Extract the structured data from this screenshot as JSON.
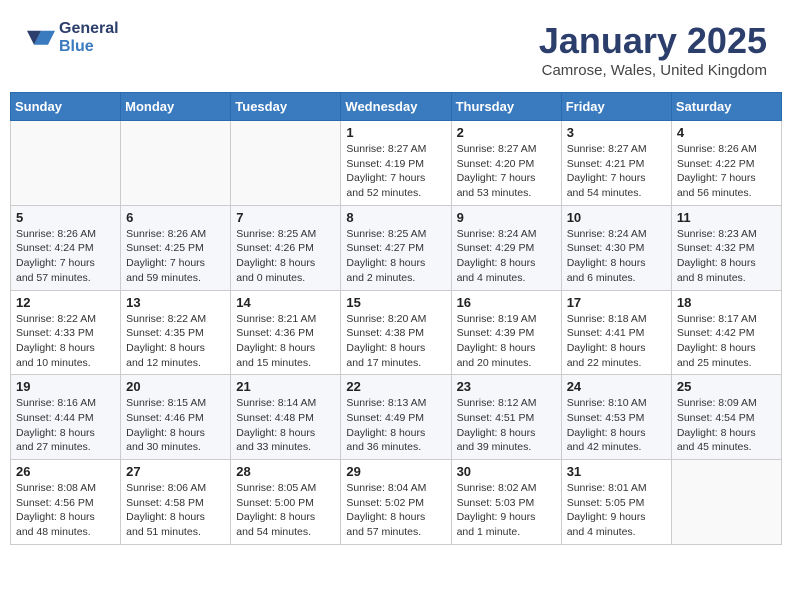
{
  "header": {
    "logo_general": "General",
    "logo_blue": "Blue",
    "month_year": "January 2025",
    "location": "Camrose, Wales, United Kingdom"
  },
  "days_of_week": [
    "Sunday",
    "Monday",
    "Tuesday",
    "Wednesday",
    "Thursday",
    "Friday",
    "Saturday"
  ],
  "weeks": [
    [
      {
        "day": "",
        "info": ""
      },
      {
        "day": "",
        "info": ""
      },
      {
        "day": "",
        "info": ""
      },
      {
        "day": "1",
        "info": "Sunrise: 8:27 AM\nSunset: 4:19 PM\nDaylight: 7 hours and 52 minutes."
      },
      {
        "day": "2",
        "info": "Sunrise: 8:27 AM\nSunset: 4:20 PM\nDaylight: 7 hours and 53 minutes."
      },
      {
        "day": "3",
        "info": "Sunrise: 8:27 AM\nSunset: 4:21 PM\nDaylight: 7 hours and 54 minutes."
      },
      {
        "day": "4",
        "info": "Sunrise: 8:26 AM\nSunset: 4:22 PM\nDaylight: 7 hours and 56 minutes."
      }
    ],
    [
      {
        "day": "5",
        "info": "Sunrise: 8:26 AM\nSunset: 4:24 PM\nDaylight: 7 hours and 57 minutes."
      },
      {
        "day": "6",
        "info": "Sunrise: 8:26 AM\nSunset: 4:25 PM\nDaylight: 7 hours and 59 minutes."
      },
      {
        "day": "7",
        "info": "Sunrise: 8:25 AM\nSunset: 4:26 PM\nDaylight: 8 hours and 0 minutes."
      },
      {
        "day": "8",
        "info": "Sunrise: 8:25 AM\nSunset: 4:27 PM\nDaylight: 8 hours and 2 minutes."
      },
      {
        "day": "9",
        "info": "Sunrise: 8:24 AM\nSunset: 4:29 PM\nDaylight: 8 hours and 4 minutes."
      },
      {
        "day": "10",
        "info": "Sunrise: 8:24 AM\nSunset: 4:30 PM\nDaylight: 8 hours and 6 minutes."
      },
      {
        "day": "11",
        "info": "Sunrise: 8:23 AM\nSunset: 4:32 PM\nDaylight: 8 hours and 8 minutes."
      }
    ],
    [
      {
        "day": "12",
        "info": "Sunrise: 8:22 AM\nSunset: 4:33 PM\nDaylight: 8 hours and 10 minutes."
      },
      {
        "day": "13",
        "info": "Sunrise: 8:22 AM\nSunset: 4:35 PM\nDaylight: 8 hours and 12 minutes."
      },
      {
        "day": "14",
        "info": "Sunrise: 8:21 AM\nSunset: 4:36 PM\nDaylight: 8 hours and 15 minutes."
      },
      {
        "day": "15",
        "info": "Sunrise: 8:20 AM\nSunset: 4:38 PM\nDaylight: 8 hours and 17 minutes."
      },
      {
        "day": "16",
        "info": "Sunrise: 8:19 AM\nSunset: 4:39 PM\nDaylight: 8 hours and 20 minutes."
      },
      {
        "day": "17",
        "info": "Sunrise: 8:18 AM\nSunset: 4:41 PM\nDaylight: 8 hours and 22 minutes."
      },
      {
        "day": "18",
        "info": "Sunrise: 8:17 AM\nSunset: 4:42 PM\nDaylight: 8 hours and 25 minutes."
      }
    ],
    [
      {
        "day": "19",
        "info": "Sunrise: 8:16 AM\nSunset: 4:44 PM\nDaylight: 8 hours and 27 minutes."
      },
      {
        "day": "20",
        "info": "Sunrise: 8:15 AM\nSunset: 4:46 PM\nDaylight: 8 hours and 30 minutes."
      },
      {
        "day": "21",
        "info": "Sunrise: 8:14 AM\nSunset: 4:48 PM\nDaylight: 8 hours and 33 minutes."
      },
      {
        "day": "22",
        "info": "Sunrise: 8:13 AM\nSunset: 4:49 PM\nDaylight: 8 hours and 36 minutes."
      },
      {
        "day": "23",
        "info": "Sunrise: 8:12 AM\nSunset: 4:51 PM\nDaylight: 8 hours and 39 minutes."
      },
      {
        "day": "24",
        "info": "Sunrise: 8:10 AM\nSunset: 4:53 PM\nDaylight: 8 hours and 42 minutes."
      },
      {
        "day": "25",
        "info": "Sunrise: 8:09 AM\nSunset: 4:54 PM\nDaylight: 8 hours and 45 minutes."
      }
    ],
    [
      {
        "day": "26",
        "info": "Sunrise: 8:08 AM\nSunset: 4:56 PM\nDaylight: 8 hours and 48 minutes."
      },
      {
        "day": "27",
        "info": "Sunrise: 8:06 AM\nSunset: 4:58 PM\nDaylight: 8 hours and 51 minutes."
      },
      {
        "day": "28",
        "info": "Sunrise: 8:05 AM\nSunset: 5:00 PM\nDaylight: 8 hours and 54 minutes."
      },
      {
        "day": "29",
        "info": "Sunrise: 8:04 AM\nSunset: 5:02 PM\nDaylight: 8 hours and 57 minutes."
      },
      {
        "day": "30",
        "info": "Sunrise: 8:02 AM\nSunset: 5:03 PM\nDaylight: 9 hours and 1 minute."
      },
      {
        "day": "31",
        "info": "Sunrise: 8:01 AM\nSunset: 5:05 PM\nDaylight: 9 hours and 4 minutes."
      },
      {
        "day": "",
        "info": ""
      }
    ]
  ]
}
